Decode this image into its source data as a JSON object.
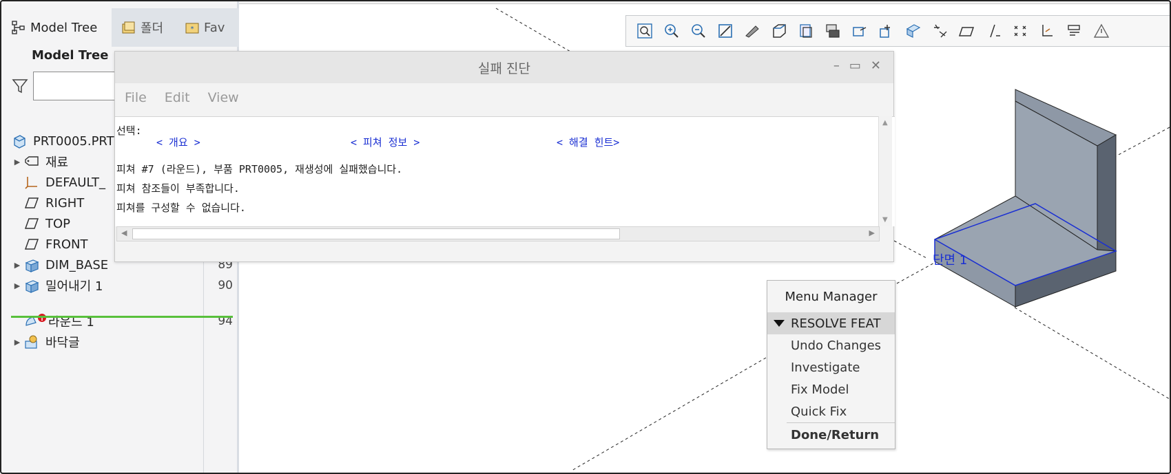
{
  "left_panel": {
    "tabs": [
      {
        "label": "Model Tree",
        "active": true
      },
      {
        "label": "폴더",
        "active": false
      },
      {
        "label": "Fav",
        "active": false
      }
    ],
    "subheader": "Model Tree",
    "filter_placeholder": "",
    "tree": [
      {
        "label": "PRT0005.PRT",
        "icon": "part-icon",
        "expandable": false,
        "num": ""
      },
      {
        "label": "재료",
        "icon": "material-icon",
        "expandable": true,
        "num": ""
      },
      {
        "label": "DEFAULT_",
        "icon": "csys-icon",
        "expandable": false,
        "num": ""
      },
      {
        "label": "RIGHT",
        "icon": "datum-plane-icon",
        "expandable": false,
        "num": ""
      },
      {
        "label": "TOP",
        "icon": "datum-plane-icon",
        "expandable": false,
        "num": ""
      },
      {
        "label": "FRONT",
        "icon": "datum-plane-icon",
        "expandable": false,
        "num": ""
      },
      {
        "label": "DIM_BASE",
        "icon": "extrude-icon",
        "expandable": true,
        "num": "89"
      },
      {
        "label": "밀어내기 1",
        "icon": "extrude-icon",
        "expandable": true,
        "num": "90"
      },
      {
        "label": "라운드 1",
        "icon": "round-error-icon",
        "expandable": false,
        "num": "94"
      },
      {
        "label": "바닥글",
        "icon": "footer-icon",
        "expandable": true,
        "num": ""
      }
    ]
  },
  "toolbar": {
    "icons": [
      "zoom-refit-icon",
      "zoom-in-icon",
      "zoom-out-icon",
      "repaint-icon",
      "display-style-icon",
      "view-orient-icon",
      "saved-views-icon",
      "view-manager-icon",
      "datum-display-icon",
      "spin-center-icon",
      "annotation-icon",
      "plane-display-icon",
      "axis-display-icon",
      "point-display-icon",
      "csys-display-icon",
      "layers-icon",
      "section-icon",
      "warning-icon"
    ]
  },
  "dialog": {
    "title": "실패 진단",
    "menu": [
      "File",
      "Edit",
      "View"
    ],
    "selection_label": "선택:",
    "links": [
      "< 개요 >",
      "< 피쳐 정보 >",
      "< 해결 힌트>"
    ],
    "lines": [
      "피쳐 #7 (라운드), 부품 PRT0005, 재생성에 실패했습니다.",
      "피쳐 참조들이 부족합니다.",
      "피쳐를 구성할 수 없습니다."
    ]
  },
  "menu_manager": {
    "title": "Menu Manager",
    "header": "RESOLVE FEAT",
    "items": [
      "Undo Changes",
      "Investigate",
      "Fix Model",
      "Quick Fix"
    ],
    "done": "Done/Return"
  },
  "viewport": {
    "section_label": "단면 1",
    "colors": {
      "model_light": "#9aa4b1",
      "model_mid": "#7d8795",
      "model_dark": "#5a6370",
      "section_line": "#1a2fd3"
    }
  }
}
